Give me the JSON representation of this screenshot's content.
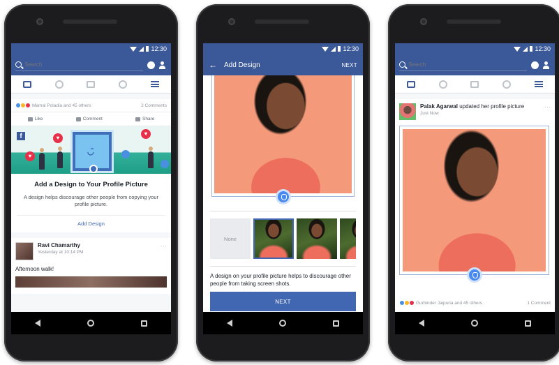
{
  "status": {
    "time": "12:30"
  },
  "header": {
    "search_placeholder": "Search"
  },
  "phone1": {
    "reactions_text": "Mamal Poladia and 45 others",
    "comments_count": "2 Comments",
    "actions": {
      "like": "Like",
      "comment": "Comment",
      "share": "Share"
    },
    "prompt": {
      "title": "Add a Design to Your Profile Picture",
      "description": "A design helps discourage other people from copying your profile picture.",
      "link": "Add Design"
    },
    "post": {
      "author": "Ravi Chamarthy",
      "time": "Yesterday at 10:14 PM",
      "text": "Afternoon walk!"
    }
  },
  "phone2": {
    "title": "Add Design",
    "next_label": "NEXT",
    "none_label": "None",
    "description": "A design on your profile picture helps to discourage other people from taking screen shots.",
    "button_label": "NEXT"
  },
  "phone3": {
    "author": "Palak Agarwal",
    "action_text": "updated her profile picture",
    "time": "Just Now",
    "reactions_text": "Gurbinder Jaipuria and 45 others",
    "comments_count": "1 Comment"
  },
  "colors": {
    "brand": "#3b5998",
    "accent": "#4267b2"
  }
}
